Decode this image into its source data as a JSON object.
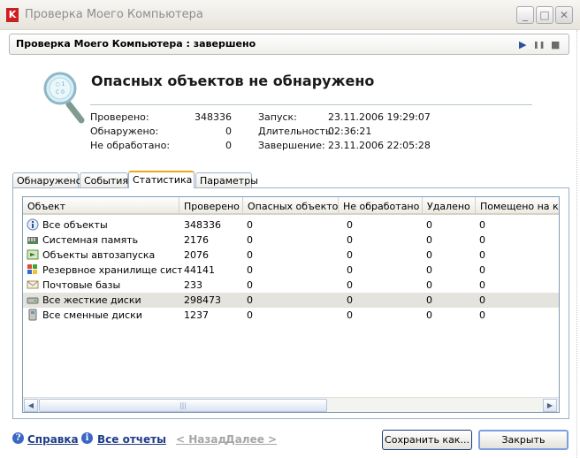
{
  "window": {
    "title": "Проверка Моего Компьютера",
    "logo_letter": "K",
    "minimize": "_",
    "maximize": "□",
    "close": "✕"
  },
  "status": {
    "text": "Проверка Моего Компьютера : завершено",
    "play": "▶",
    "pause": "❚❚",
    "stop": "■"
  },
  "summary": {
    "headline": "Опасных объектов не обнаружено",
    "scanned_label": "Проверено:",
    "scanned_value": "348336",
    "detected_label": "Обнаружено:",
    "detected_value": "0",
    "unprocessed_label": "Не обработано:",
    "unprocessed_value": "0",
    "start_label": "Запуск:",
    "start_value": "23.11.2006 19:29:07",
    "duration_label": "Длительность:",
    "duration_value": "02:36:21",
    "finish_label": "Завершение:",
    "finish_value": "23.11.2006 22:05:28"
  },
  "tabs": [
    {
      "label": "Обнаружено"
    },
    {
      "label": "События"
    },
    {
      "label": "Статистика"
    },
    {
      "label": "Параметры"
    }
  ],
  "active_tab": "Статистика",
  "table": {
    "columns": [
      "Объект",
      "Проверено",
      "Опасных объектов",
      "Не обработано",
      "Удалено",
      "Помещено на кар"
    ],
    "rows": [
      {
        "icon": "info-icon",
        "name": "Все объекты",
        "scanned": "348336",
        "dangerous": "0",
        "unprocessed": "0",
        "deleted": "0",
        "quarantined": "0"
      },
      {
        "icon": "memory-icon",
        "name": "Системная память",
        "scanned": "2176",
        "dangerous": "0",
        "unprocessed": "0",
        "deleted": "0",
        "quarantined": "0"
      },
      {
        "icon": "startup-icon",
        "name": "Объекты автозапуска",
        "scanned": "2076",
        "dangerous": "0",
        "unprocessed": "0",
        "deleted": "0",
        "quarantined": "0"
      },
      {
        "icon": "windows-icon",
        "name": "Резервное хранилище систе...",
        "scanned": "44141",
        "dangerous": "0",
        "unprocessed": "0",
        "deleted": "0",
        "quarantined": "0"
      },
      {
        "icon": "mail-icon",
        "name": "Почтовые базы",
        "scanned": "233",
        "dangerous": "0",
        "unprocessed": "0",
        "deleted": "0",
        "quarantined": "0"
      },
      {
        "icon": "hard-disk-icon",
        "name": "Все жесткие диски",
        "scanned": "298473",
        "dangerous": "0",
        "unprocessed": "0",
        "deleted": "0",
        "quarantined": "0"
      },
      {
        "icon": "removable-disk-icon",
        "name": "Все сменные диски",
        "scanned": "1237",
        "dangerous": "0",
        "unprocessed": "0",
        "deleted": "0",
        "quarantined": "0"
      }
    ],
    "selected_row": "Все жесткие диски"
  },
  "footer": {
    "help": "Справка",
    "all_reports": "Все отчеты",
    "back": "< Назад",
    "next": "Далее >",
    "save_as": "Сохранить как...",
    "close": "Закрыть"
  },
  "colors": {
    "accent_tab": "#f0a71a",
    "link": "#1f3c88",
    "selection": "#e4e3de"
  }
}
